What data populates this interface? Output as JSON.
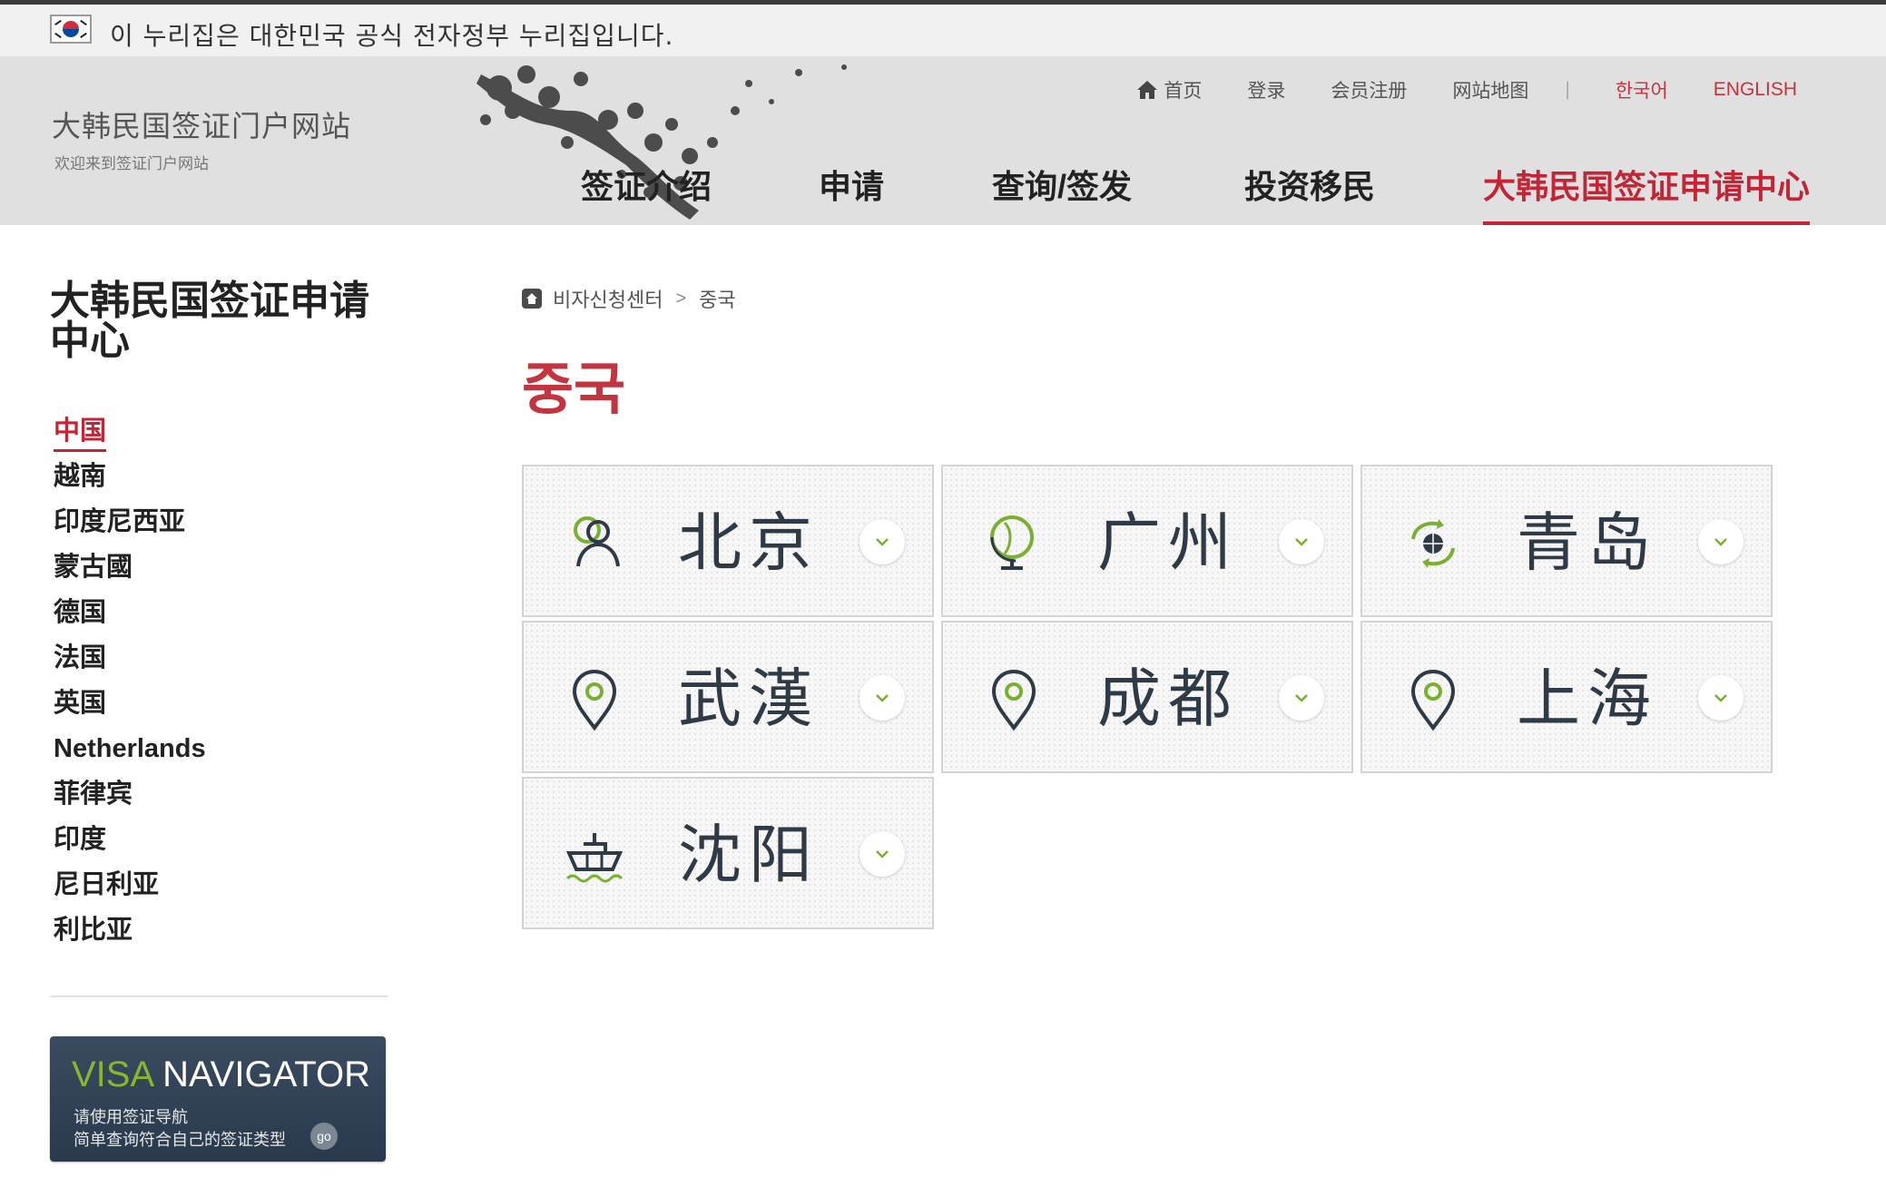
{
  "gov_banner": {
    "text": "이 누리집은 대한민국 공식 전자정부 누리집입니다."
  },
  "header": {
    "site_title": "大韩民国签证门户网站",
    "site_subtitle": "欢迎来到签证门户网站",
    "utility_links": {
      "home": "首页",
      "login": "登录",
      "register": "会员注册",
      "sitemap": "网站地图",
      "separator": "|",
      "korean": "한국어",
      "english": "ENGLISH"
    },
    "main_nav": [
      {
        "label": "签证介绍"
      },
      {
        "label": "申请"
      },
      {
        "label": "查询/签发"
      },
      {
        "label": "投资移民"
      },
      {
        "label": "大韩民国签证申请中心",
        "active": true
      }
    ]
  },
  "sidebar": {
    "title": "大韩民国签证申请中心",
    "items": [
      {
        "label": "中国",
        "active": true
      },
      {
        "label": "越南"
      },
      {
        "label": "印度尼西亚"
      },
      {
        "label": "蒙古國"
      },
      {
        "label": "德国"
      },
      {
        "label": "法国"
      },
      {
        "label": "英国"
      },
      {
        "label": "Netherlands"
      },
      {
        "label": "菲律宾"
      },
      {
        "label": "印度"
      },
      {
        "label": "尼日利亚"
      },
      {
        "label": "利比亚"
      }
    ],
    "visa_navigator": {
      "title_green": "VISA",
      "title_white": "NAVIGATOR",
      "line1": "请使用签证导航",
      "line2": "简单查询符合自己的签证类型",
      "go": "go"
    }
  },
  "breadcrumb": {
    "home_icon": "home-icon",
    "items": [
      "비자신청센터",
      "중국"
    ],
    "separator": ">"
  },
  "page_title": "중국",
  "cities": [
    {
      "label": "北京",
      "icon": "person-icon"
    },
    {
      "label": "广州",
      "icon": "globe-icon"
    },
    {
      "label": "青岛",
      "icon": "world-arrows-icon"
    },
    {
      "label": "武漢",
      "icon": "map-pin-icon"
    },
    {
      "label": "成都",
      "icon": "map-pin-icon"
    },
    {
      "label": "上海",
      "icon": "map-pin-icon"
    },
    {
      "label": "沈阳",
      "icon": "ship-icon"
    }
  ],
  "colors": {
    "accent_red": "#c32536",
    "icon_green": "#7ab030",
    "icon_dark": "#2e3a46"
  }
}
